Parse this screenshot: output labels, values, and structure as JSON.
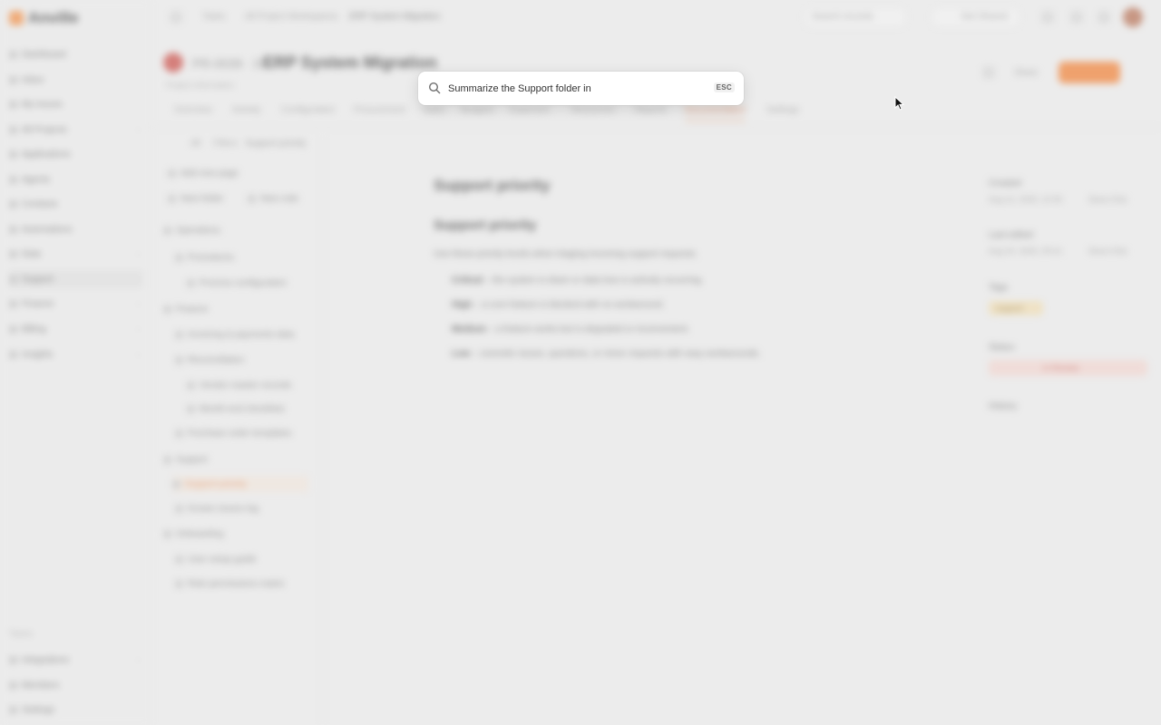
{
  "app": {
    "name": "Anville"
  },
  "sidebar": {
    "items": [
      {
        "label": "Dashboard"
      },
      {
        "label": "Inbox"
      },
      {
        "label": "My Issues"
      },
      {
        "label": "All Projects"
      },
      {
        "label": "Applications"
      },
      {
        "label": "Agents"
      },
      {
        "label": "Contacts"
      },
      {
        "label": "Automations"
      },
      {
        "label": "Data"
      },
      {
        "label": "Support"
      },
      {
        "label": "Finance"
      },
      {
        "label": "Billing"
      },
      {
        "label": "Insights"
      }
    ],
    "section": "Teams",
    "bottom_items": [
      {
        "label": "Integrations"
      },
      {
        "label": "Members"
      },
      {
        "label": "Settings"
      }
    ]
  },
  "topbar": {
    "crumb1": "Tasks",
    "crumb2": "All Project Workspaces",
    "crumb3": "ERP System Migration",
    "search_placeholder": "Search records",
    "share_label": "Not Shared"
  },
  "page": {
    "prefix": "PR-0039 · D",
    "title": "ERP System Migration",
    "subtitle": "Project information",
    "create_label": "Create Issue",
    "share_btn": "Share"
  },
  "tabs": [
    "Overview",
    "Activity",
    "Configuration",
    "Procurement",
    "Tasks",
    "Budgets",
    "Expenses",
    "Resources",
    "Reports",
    "Documentation",
    "Settings"
  ],
  "tree": {
    "toolbar": [
      "All",
      "Filters",
      "Support priority"
    ],
    "items": [
      {
        "label": "Add new page"
      },
      {
        "label": "New folder"
      },
      {
        "label": "New note"
      },
      {
        "label": "Operations"
      },
      {
        "label": "Procedures"
      },
      {
        "label": "Process configuration"
      },
      {
        "label": "Finance"
      },
      {
        "label": "Invoicing & payments data"
      },
      {
        "label": "Reconciliation"
      },
      {
        "label": "Vendor master records"
      },
      {
        "label": "Month-end checklists"
      },
      {
        "label": "Purchase order templates"
      },
      {
        "label": "Support"
      },
      {
        "label": "Support priority"
      },
      {
        "label": "Known issues log"
      },
      {
        "label": "Onboarding"
      },
      {
        "label": "User setup guide"
      },
      {
        "label": "Role permissions matrix"
      }
    ]
  },
  "doc": {
    "title": "Support priority",
    "heading": "Support priority",
    "intro": "Use these priority levels when triaging incoming support requests.",
    "items": [
      {
        "key": "Critical",
        "text": "– the system is down or data loss is actively occurring."
      },
      {
        "key": "High",
        "text": "– a core feature is blocked with no workaround."
      },
      {
        "key": "Medium",
        "text": "– a feature works but is degraded or inconvenient."
      },
      {
        "key": "Low",
        "text": "– cosmetic issues, questions, or minor requests with easy workarounds."
      }
    ]
  },
  "meta": {
    "created_label": "Created",
    "created_val": "Aug 12, 2025, 10:35",
    "created_by": "Dana Ortiz",
    "updated_label": "Last edited",
    "updated_val": "Aug 15, 2025, 09:21",
    "updated_by": "Dana Ortiz",
    "tags_label": "Tags",
    "tag": "support",
    "status_label": "Status",
    "status": "In Review",
    "history_label": "History"
  },
  "palette": {
    "value": "Summarize the Support folder in",
    "esc": "ESC"
  }
}
